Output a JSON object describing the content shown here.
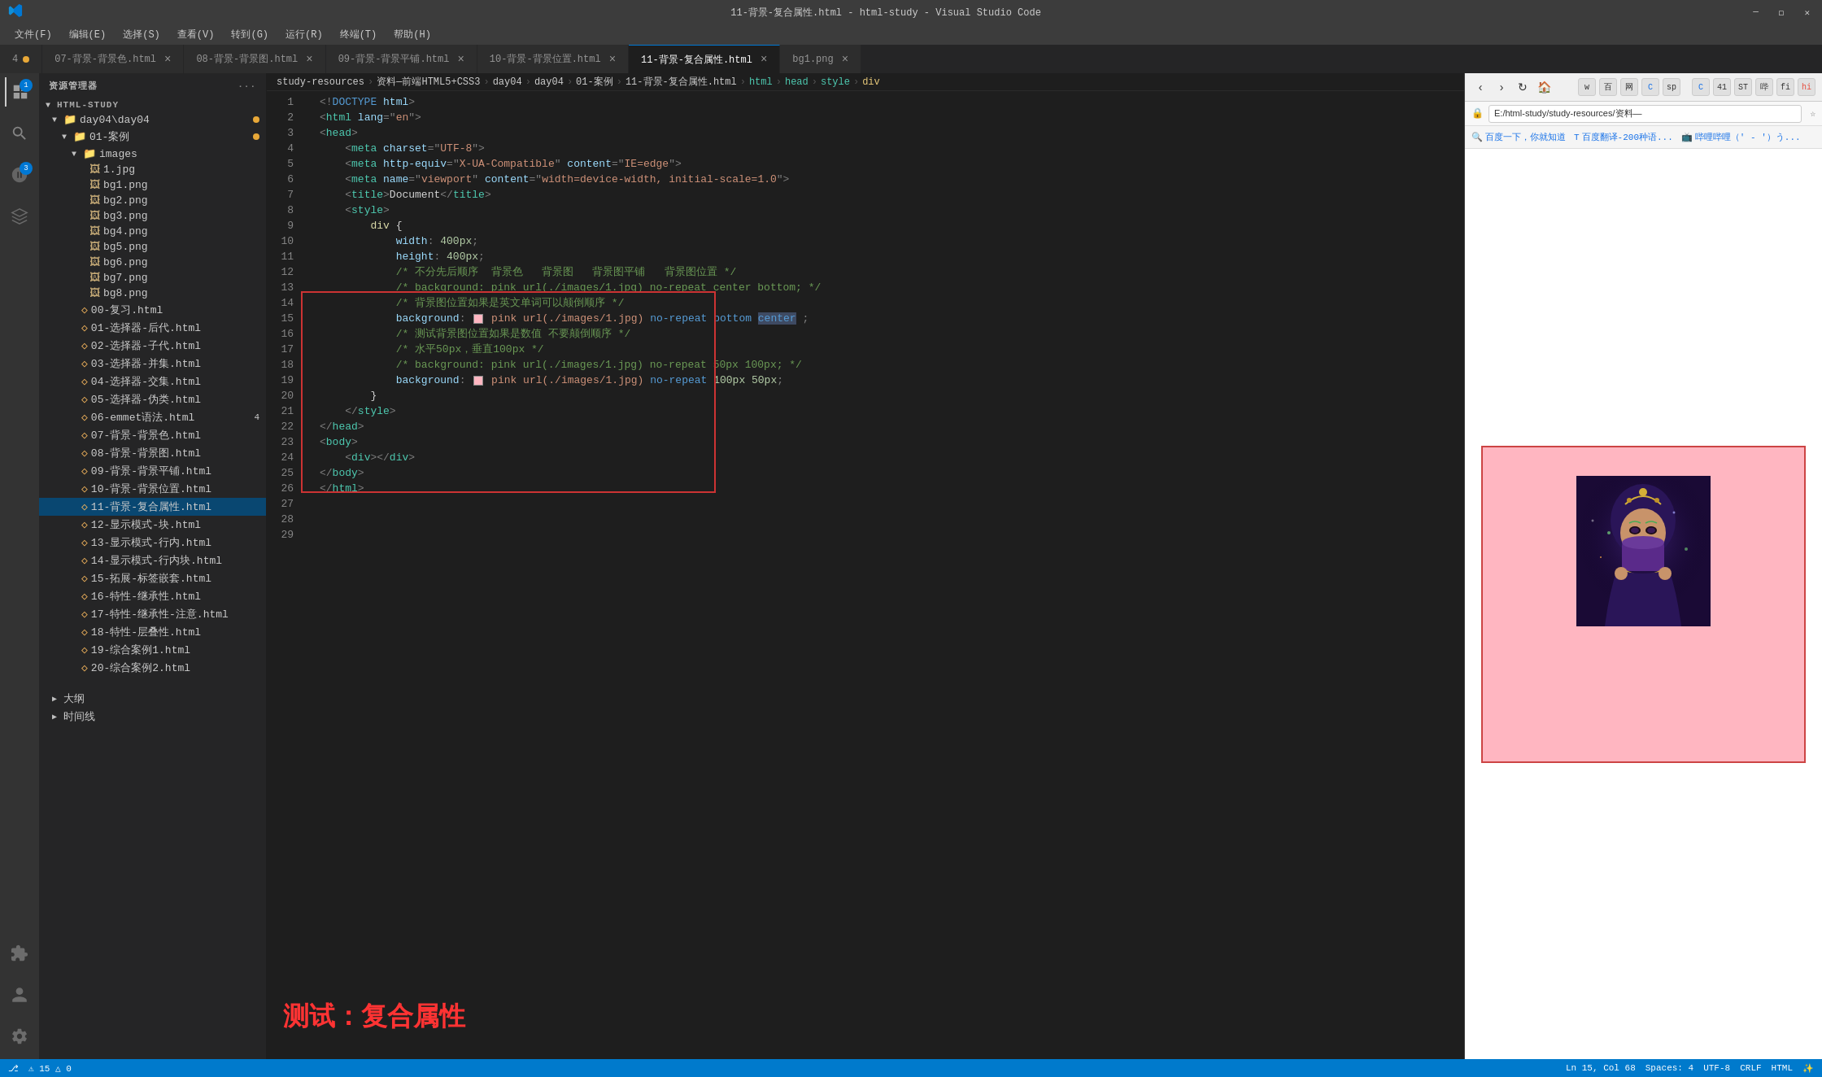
{
  "titleBar": {
    "title": "11-背景-复合属性.html - html-study - Visual Studio Code",
    "windowControls": [
      "minimize",
      "maximize",
      "close"
    ]
  },
  "menuBar": {
    "items": [
      "文件(F)",
      "编辑(E)",
      "选择(S)",
      "查看(V)",
      "转到(G)",
      "运行(R)",
      "终端(T)",
      "帮助(H)"
    ]
  },
  "tabs": [
    {
      "label": "4",
      "dot": true,
      "active": false
    },
    {
      "label": "07-背景-背景色.html",
      "active": false
    },
    {
      "label": "08-背景-背景图.html",
      "dot": false,
      "active": false
    },
    {
      "label": "09-背景-背景平铺.html",
      "dot": false,
      "active": false
    },
    {
      "label": "10-背景-背景位置.html",
      "dot": false,
      "active": false
    },
    {
      "label": "11-背景-复合属性.html",
      "active": true
    },
    {
      "label": "bg1.png",
      "active": false
    }
  ],
  "sidebar": {
    "title": "资源管理器",
    "rootName": "HTML-STUDY",
    "items": [
      {
        "label": "day04\\day04",
        "indent": 1,
        "type": "folder",
        "open": true,
        "dot": true
      },
      {
        "label": "01-案例",
        "indent": 2,
        "type": "folder",
        "open": true,
        "dot": true
      },
      {
        "label": "images",
        "indent": 3,
        "type": "folder",
        "open": true
      },
      {
        "label": "1.jpg",
        "indent": 4,
        "type": "image"
      },
      {
        "label": "bg1.png",
        "indent": 4,
        "type": "image"
      },
      {
        "label": "bg2.png",
        "indent": 4,
        "type": "image"
      },
      {
        "label": "bg3.png",
        "indent": 4,
        "type": "image"
      },
      {
        "label": "bg4.png",
        "indent": 4,
        "type": "image"
      },
      {
        "label": "bg5.png",
        "indent": 4,
        "type": "image"
      },
      {
        "label": "bg6.png",
        "indent": 4,
        "type": "image"
      },
      {
        "label": "bg7.png",
        "indent": 4,
        "type": "image"
      },
      {
        "label": "bg8.png",
        "indent": 4,
        "type": "image"
      },
      {
        "label": "00-复习.html",
        "indent": 3,
        "type": "html"
      },
      {
        "label": "01-选择器-后代.html",
        "indent": 3,
        "type": "html"
      },
      {
        "label": "02-选择器-子代.html",
        "indent": 3,
        "type": "html"
      },
      {
        "label": "03-选择器-并集.html",
        "indent": 3,
        "type": "html"
      },
      {
        "label": "04-选择器-交集.html",
        "indent": 3,
        "type": "html"
      },
      {
        "label": "05-选择器-伪类.html",
        "indent": 3,
        "type": "html"
      },
      {
        "label": "06-emmet语法.html",
        "indent": 3,
        "type": "html",
        "badge": "4",
        "active": false
      },
      {
        "label": "07-背景-背景色.html",
        "indent": 3,
        "type": "html"
      },
      {
        "label": "08-背景-背景图.html",
        "indent": 3,
        "type": "html"
      },
      {
        "label": "09-背景-背景平铺.html",
        "indent": 3,
        "type": "html"
      },
      {
        "label": "10-背景-背景位置.html",
        "indent": 3,
        "type": "html"
      },
      {
        "label": "11-背景-复合属性.html",
        "indent": 3,
        "type": "html",
        "active": true
      },
      {
        "label": "12-显示模式-块.html",
        "indent": 3,
        "type": "html"
      },
      {
        "label": "13-显示模式-行内.html",
        "indent": 3,
        "type": "html"
      },
      {
        "label": "14-显示模式-行内块.html",
        "indent": 3,
        "type": "html"
      },
      {
        "label": "15-拓展-标签嵌套.html",
        "indent": 3,
        "type": "html"
      },
      {
        "label": "16-特性-继承性.html",
        "indent": 3,
        "type": "html"
      },
      {
        "label": "17-特性-继承性-注意.html",
        "indent": 3,
        "type": "html"
      },
      {
        "label": "18-特性-层叠性.html",
        "indent": 3,
        "type": "html"
      },
      {
        "label": "19-综合案例1.html",
        "indent": 3,
        "type": "html"
      },
      {
        "label": "20-综合案例2.html",
        "indent": 3,
        "type": "html"
      }
    ],
    "bottomItems": [
      "大纲",
      "时间线"
    ]
  },
  "breadcrumb": {
    "path": [
      "study-resources",
      "资料—前端HTML5+CSS3",
      "day04",
      "day04",
      "01-案例",
      "11-背景-复合属性.html",
      "html",
      "head",
      "style",
      "div"
    ]
  },
  "editor": {
    "lines": [
      {
        "num": 1,
        "content": "<!DOCTYPE html>"
      },
      {
        "num": 2,
        "content": "<html lang=\"en\">"
      },
      {
        "num": 3,
        "content": "<head>"
      },
      {
        "num": 4,
        "content": "    <meta charset=\"UTF-8\">"
      },
      {
        "num": 5,
        "content": "    <meta http-equiv=\"X-UA-Compatible\" content=\"IE=edge\">"
      },
      {
        "num": 6,
        "content": "    <meta name=\"viewport\" content=\"width=device-width, initial-scale=1.0\">"
      },
      {
        "num": 7,
        "content": "    <title>Document</title>"
      },
      {
        "num": 8,
        "content": "    <style>"
      },
      {
        "num": 9,
        "content": "        div {"
      },
      {
        "num": 10,
        "content": "            width: 400px;"
      },
      {
        "num": 11,
        "content": "            height: 400px;"
      },
      {
        "num": 12,
        "content": "            /* 不分先后顺序  背景色   背景图   背景图平铺   背景图位置 */"
      },
      {
        "num": 13,
        "content": "            /* background: pink url(./images/1.jpg) no-repeat center bottom; */"
      },
      {
        "num": 14,
        "content": "            /* 背景图位置如果是英文单词可以颠倒顺序 */"
      },
      {
        "num": 15,
        "content": "            background: ■ pink url(./images/1.jpg) no-repeat bottom center ;"
      },
      {
        "num": 16,
        "content": ""
      },
      {
        "num": 17,
        "content": "            /* 测试背景图位置如果是数值 不要颠倒顺序 */"
      },
      {
        "num": 18,
        "content": "            /* 水平50px，垂直100px */"
      },
      {
        "num": 19,
        "content": "            /* background: pink url(./images/1.jpg) no-repeat 50px 100px; */"
      },
      {
        "num": 20,
        "content": "            background: ■ pink url(./images/1.jpg) no-repeat 100px 50px;"
      },
      {
        "num": 21,
        "content": ""
      },
      {
        "num": 22,
        "content": ""
      },
      {
        "num": 23,
        "content": "        }"
      },
      {
        "num": 24,
        "content": "    </style>"
      },
      {
        "num": 25,
        "content": "</head>"
      },
      {
        "num": 26,
        "content": "<body>"
      },
      {
        "num": 27,
        "content": "    <div></div>"
      },
      {
        "num": 28,
        "content": "</body>"
      },
      {
        "num": 29,
        "content": "</html>"
      }
    ]
  },
  "preview": {
    "urlBar": "E:/html-study/study-resources/资料—",
    "bookmarks": [
      {
        "label": "百度一下，你就知道"
      },
      {
        "label": "百度翻译-200种语..."
      },
      {
        "label": "哔哩哔哩（' - '）う..."
      }
    ],
    "demoText": "测试：复合属性"
  },
  "statusBar": {
    "left": [
      "⎇ 15 △ 0"
    ],
    "encoding": "UTF-8",
    "lineEnding": "CRLF",
    "language": "HTML",
    "position": "Ln 15, Col 68"
  }
}
